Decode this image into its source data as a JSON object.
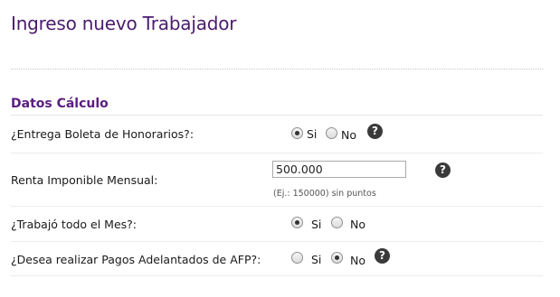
{
  "page": {
    "title": "Ingreso nuevo Trabajador"
  },
  "section": {
    "title": "Datos Cálculo"
  },
  "fields": {
    "boleta": {
      "label": "¿Entrega Boleta de Honorarios?:",
      "option_yes": "Si",
      "option_no": "No",
      "selected": "Si",
      "help_icon": "question-icon"
    },
    "renta": {
      "label": "Renta Imponible Mensual:",
      "value": "500.000",
      "hint": "(Ej.: 150000) sin puntos",
      "help_icon": "question-icon"
    },
    "trabajo_mes": {
      "label": "¿Trabajó todo el Mes?:",
      "option_yes": "Si",
      "option_no": "No",
      "selected": "Si"
    },
    "pagos_afp": {
      "label": "¿Desea realizar Pagos Adelantados de AFP?:",
      "option_yes": "Si",
      "option_no": "No",
      "selected": "No",
      "help_icon": "question-icon"
    }
  },
  "colors": {
    "title": "#4b1b6e",
    "section_title": "#5a1f80",
    "help_icon_bg": "#3a3a3a"
  }
}
